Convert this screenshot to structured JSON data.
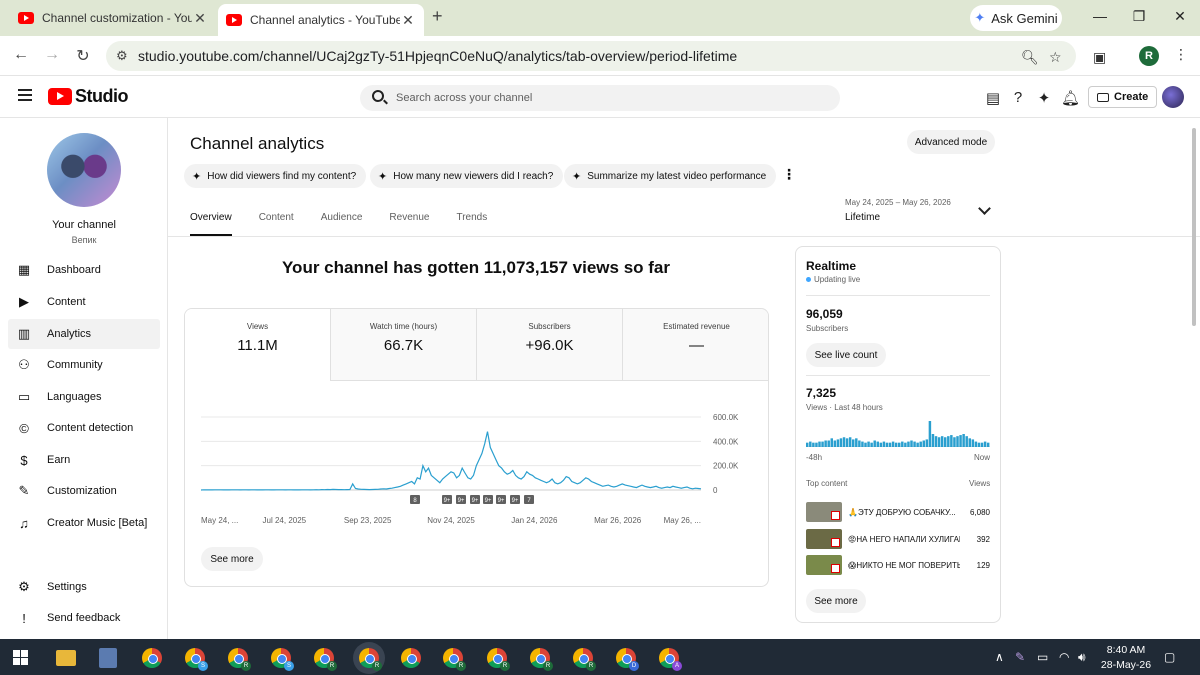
{
  "browser": {
    "tabs": [
      {
        "title": "Channel customization - YouTube Studio",
        "active": false
      },
      {
        "title": "Channel analytics - YouTube Studio",
        "active": true
      }
    ],
    "gemini_label": "Ask Gemini",
    "url": "studio.youtube.com/channel/UCaj2gzTy-51HpjeqnC0eNuQ/analytics/tab-overview/period-lifetime",
    "profile_initial": "R"
  },
  "studio": {
    "logo_text": "Studio",
    "search_placeholder": "Search across your channel",
    "create_label": "Create"
  },
  "sidebar": {
    "channel_name": "Your channel",
    "channel_handle": "Вепик",
    "items": [
      {
        "label": "Dashboard",
        "icon": "dashboard-icon"
      },
      {
        "label": "Content",
        "icon": "content-icon"
      },
      {
        "label": "Analytics",
        "icon": "analytics-icon",
        "active": true
      },
      {
        "label": "Community",
        "icon": "community-icon"
      },
      {
        "label": "Languages",
        "icon": "languages-icon"
      },
      {
        "label": "Content detection",
        "icon": "copyright-icon"
      },
      {
        "label": "Earn",
        "icon": "earn-icon"
      },
      {
        "label": "Customization",
        "icon": "customization-icon"
      },
      {
        "label": "Creator Music [Beta]",
        "icon": "music-icon"
      },
      {
        "label": "Settings",
        "icon": "settings-icon"
      },
      {
        "label": "Send feedback",
        "icon": "feedback-icon"
      }
    ]
  },
  "analytics": {
    "title": "Channel analytics",
    "advanced_mode": "Advanced mode",
    "chips": [
      "How did viewers find my content?",
      "How many new viewers did I reach?",
      "Summarize my latest video performance"
    ],
    "tabs": [
      "Overview",
      "Content",
      "Audience",
      "Revenue",
      "Trends"
    ],
    "period_range": "May 24, 2025 – May 26, 2026",
    "period_label": "Lifetime",
    "headline": "Your channel has gotten 11,073,157 views so far",
    "metrics": [
      {
        "label": "Views",
        "value": "11.1M"
      },
      {
        "label": "Watch time (hours)",
        "value": "66.7K"
      },
      {
        "label": "Subscribers",
        "value": "+96.0K"
      },
      {
        "label": "Estimated revenue",
        "value": "—"
      }
    ],
    "see_more": "See more"
  },
  "chart_data": {
    "type": "line",
    "x_labels": [
      "May 24, ...",
      "Jul 24, 2025",
      "Sep 23, 2025",
      "Nov 24, 2025",
      "Jan 24, 2026",
      "Mar 26, 2026",
      "May 26, ..."
    ],
    "y_ticks": [
      "600.0K",
      "400.0K",
      "200.0K",
      "0"
    ],
    "ylim": [
      0,
      600000
    ],
    "color": "#2a9fcf",
    "markers": [
      "8",
      "9+",
      "9+",
      "9+",
      "9+",
      "9+",
      "9+",
      "7"
    ],
    "series": [
      {
        "values": [
          0,
          1500,
          800,
          1200,
          900,
          2000,
          1500,
          1800,
          1200,
          1500,
          1000,
          2000,
          1500,
          1800,
          1200,
          1400,
          2000,
          1000,
          1500,
          1800,
          1200,
          1500,
          1000,
          2000,
          1500,
          1200,
          1000,
          1500,
          2000,
          1800,
          1200,
          1500,
          2000,
          1000,
          1500,
          1200,
          1800,
          2000,
          1500,
          1000,
          1800,
          2500,
          2000,
          3000,
          2500,
          4000,
          3000,
          5000,
          4000,
          3500,
          3000,
          2500,
          3000,
          4000,
          50000,
          12000,
          8000,
          6000,
          5000,
          4000,
          3000,
          4000,
          5000,
          6000,
          8000,
          10000,
          8000,
          12000,
          15000,
          20000,
          25000,
          30000,
          40000,
          50000,
          60000,
          70000,
          50000,
          100000,
          90000,
          200000,
          150000,
          180000,
          120000,
          100000,
          80000,
          60000,
          90000,
          110000,
          130000,
          150000,
          140000,
          100000,
          120000,
          180000,
          140000,
          100000,
          90000,
          120000,
          200000,
          250000,
          300000,
          380000,
          480000,
          350000,
          300000,
          250000,
          200000,
          180000,
          150000,
          130000,
          140000,
          160000,
          120000,
          100000,
          90000,
          110000,
          150000,
          130000,
          120000,
          100000,
          90000,
          80000,
          70000,
          60000,
          70000,
          90000,
          60000,
          50000,
          60000,
          80000,
          110000,
          100000,
          70000,
          60000,
          50000,
          60000,
          80000,
          100000,
          90000,
          70000,
          60000,
          50000,
          40000,
          30000,
          35000,
          40000,
          30000,
          25000,
          30000,
          40000,
          50000,
          40000,
          35000,
          30000,
          25000,
          20000,
          30000,
          40000,
          30000,
          25000,
          20000,
          25000,
          30000,
          20000,
          15000,
          20000,
          25000,
          20000,
          30000,
          25000,
          20000,
          15000,
          20000,
          25000,
          15000,
          10000,
          15000,
          12000,
          10000
        ]
      }
    ]
  },
  "realtime": {
    "title": "Realtime",
    "status": "Updating live",
    "subscribers_value": "96,059",
    "subscribers_label": "Subscribers",
    "see_live": "See live count",
    "views_value": "7,325",
    "views_label": "Views · Last 48 hours",
    "axis_left": "-48h",
    "axis_right": "Now",
    "bars": [
      4,
      5,
      4,
      4,
      5,
      5,
      6,
      6,
      8,
      6,
      7,
      8,
      9,
      8,
      9,
      7,
      8,
      6,
      5,
      4,
      5,
      4,
      6,
      5,
      4,
      5,
      4,
      4,
      5,
      4,
      4,
      5,
      4,
      5,
      6,
      5,
      4,
      5,
      6,
      7,
      24,
      12,
      10,
      9,
      10,
      9,
      10,
      11,
      9,
      10,
      11,
      12,
      10,
      8,
      7,
      5,
      4,
      4,
      5,
      4
    ],
    "top_content_header": "Top content",
    "views_header": "Views",
    "top_content": [
      {
        "title": "🙏ЭТУ ДОБРУЮ СОБАЧКУ...",
        "views": "6,080",
        "thumb_color": "#8a8a7a"
      },
      {
        "title": "😡НА НЕГО НАПАЛИ ХУЛИГАНЫ...",
        "views": "392",
        "thumb_color": "#6b6a45"
      },
      {
        "title": "😱НИКТО НЕ МОГ ПОВЕРИТЬ...",
        "views": "129",
        "thumb_color": "#7a8a4a"
      }
    ],
    "see_more": "See more"
  },
  "taskbar": {
    "time": "8:40 AM",
    "date": "28-May-26",
    "app_badges": [
      "S",
      "R",
      "S",
      "R",
      "R",
      "R",
      "R",
      "R",
      "R",
      "D",
      "A"
    ]
  }
}
